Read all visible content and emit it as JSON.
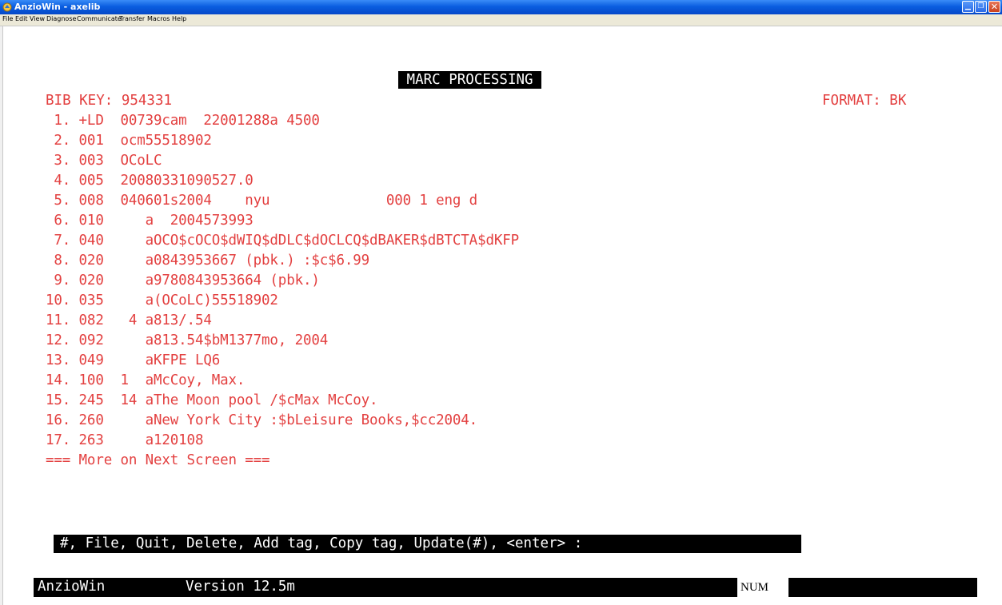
{
  "window": {
    "title": "AnzioWin - axelib",
    "titlebar_color": "#0a5ee0",
    "controls": [
      "minimize-icon",
      "maximize-icon",
      "close-icon"
    ]
  },
  "menu": [
    "File",
    "Edit",
    "View",
    "Diagnose",
    "Communicate",
    "Transfer",
    "Macros",
    "Help"
  ],
  "terminal": {
    "text_color": "#e34040",
    "screen_title": " MARC PROCESSING ",
    "bib_key": "BIB KEY: 954331",
    "format": "FORMAT: BK",
    "lines": [
      " 1. +LD  00739cam  22001288a 4500",
      " 2. 001  ocm55518902",
      " 3. 003  OCoLC",
      " 4. 005  20080331090527.0",
      " 5. 008  040601s2004    nyu              000 1 eng d",
      " 6. 010     a  2004573993",
      " 7. 040     aOCO$cOCO$dWIQ$dDLC$dOCLCQ$dBAKER$dBTCTA$dKFP",
      " 8. 020     a0843953667 (pbk.) :$c$6.99",
      " 9. 020     a9780843953664 (pbk.)",
      "10. 035     a(OCoLC)55518902",
      "11. 082   4 a813/.54",
      "12. 092     a813.54$bM1377mo, 2004",
      "13. 049     aKFPE LQ6",
      "14. 100  1  aMcCoy, Max.",
      "15. 245  14 aThe Moon pool /$cMax McCoy.",
      "16. 260     aNew York City :$bLeisure Books,$cc2004.",
      "17. 263     a120108"
    ],
    "more_notice": "=== More on Next Screen ===",
    "command_prompt": "#, File, Quit, Delete, Add tag, Copy tag, Update(#), <enter> :"
  },
  "status_bar": {
    "app_name": "AnzioWin",
    "version": "Version 12.5m",
    "num_indicator": "NUM"
  }
}
